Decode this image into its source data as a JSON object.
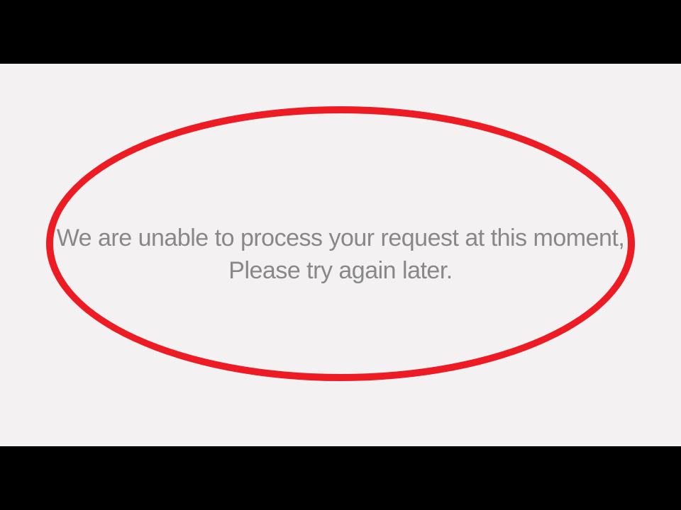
{
  "error": {
    "message": "We are unable to process your request at this moment, Please try again later."
  }
}
